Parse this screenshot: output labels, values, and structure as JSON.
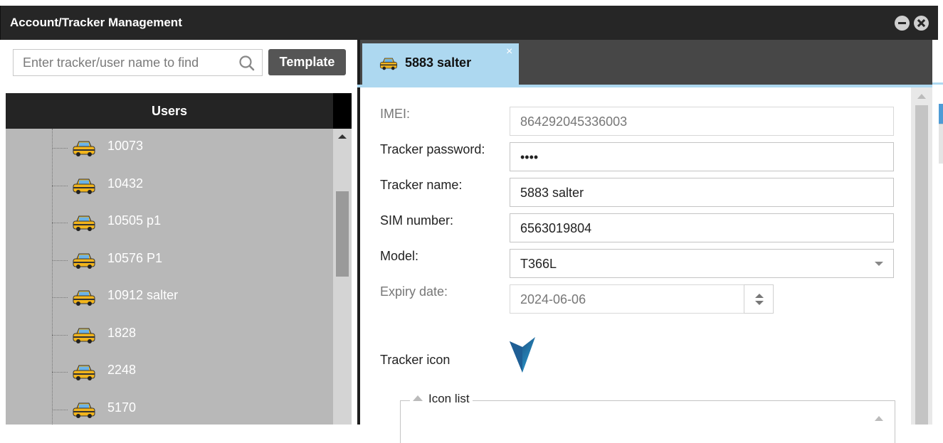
{
  "window": {
    "title": "Account/Tracker Management"
  },
  "search": {
    "placeholder": "Enter tracker/user name to find",
    "template_label": "Template"
  },
  "tree": {
    "header": "Users",
    "items": [
      {
        "label": "10073"
      },
      {
        "label": "10432"
      },
      {
        "label": "10505 p1"
      },
      {
        "label": "10576 P1"
      },
      {
        "label": "10912 salter"
      },
      {
        "label": "1828"
      },
      {
        "label": "2248"
      },
      {
        "label": "5170"
      }
    ]
  },
  "tab": {
    "label": "5883 salter",
    "close": "×"
  },
  "form": {
    "imei_label": "IMEI:",
    "imei_value": "864292045336003",
    "password_label": "Tracker password:",
    "password_value": "••••",
    "name_label": "Tracker name:",
    "name_value": "5883 salter",
    "sim_label": "SIM number:",
    "sim_value": "6563019804",
    "model_label": "Model:",
    "model_value": "T366L",
    "expiry_label": "Expiry date:",
    "expiry_value": "2024-06-06",
    "tracker_icon_label": "Tracker icon",
    "icon_list_label": "Icon list"
  },
  "colors": {
    "titlebar": "#262626",
    "tab_active": "#add8f0",
    "tree_bg": "#b8b8b8",
    "icon_blue": "#2a9ad0"
  }
}
